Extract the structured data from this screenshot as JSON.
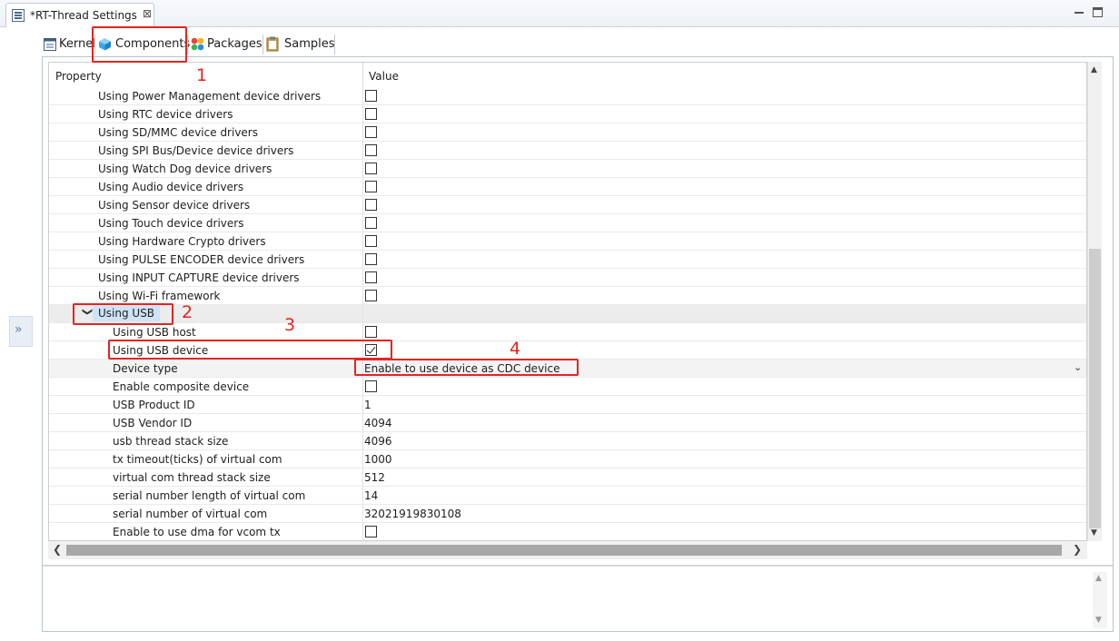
{
  "editor_tab": {
    "title": "*RT-Thread Settings",
    "close_glyph": "⊠"
  },
  "left_gutter": {
    "glyph": "»"
  },
  "inner_tabs": [
    {
      "label": "Kernel",
      "icon": "kernel-icon"
    },
    {
      "label": "Components",
      "icon": "cube-icon"
    },
    {
      "label": "Packages",
      "icon": "packages-icon"
    },
    {
      "label": "Samples",
      "icon": "clipboard-icon"
    }
  ],
  "table": {
    "header_property": "Property",
    "header_value": "Value",
    "rows": [
      {
        "label": "Using Power Management device drivers",
        "type": "checkbox",
        "checked": false
      },
      {
        "label": "Using RTC device drivers",
        "type": "checkbox",
        "checked": false
      },
      {
        "label": "Using SD/MMC device drivers",
        "type": "checkbox",
        "checked": false
      },
      {
        "label": "Using SPI Bus/Device device drivers",
        "type": "checkbox",
        "checked": false
      },
      {
        "label": "Using Watch Dog device drivers",
        "type": "checkbox",
        "checked": false
      },
      {
        "label": "Using Audio device drivers",
        "type": "checkbox",
        "checked": false
      },
      {
        "label": "Using Sensor device drivers",
        "type": "checkbox",
        "checked": false
      },
      {
        "label": "Using Touch device drivers",
        "type": "checkbox",
        "checked": false
      },
      {
        "label": "Using Hardware Crypto drivers",
        "type": "checkbox",
        "checked": false
      },
      {
        "label": "Using PULSE ENCODER device drivers",
        "type": "checkbox",
        "checked": false
      },
      {
        "label": "Using INPUT CAPTURE device drivers",
        "type": "checkbox",
        "checked": false
      },
      {
        "label": "Using Wi-Fi framework",
        "type": "checkbox",
        "checked": false
      },
      {
        "label": "Using USB",
        "type": "group",
        "expanded_glyph": "❯"
      },
      {
        "label": "Using USB host",
        "type": "checkbox",
        "checked": false
      },
      {
        "label": "Using USB device",
        "type": "checkbox",
        "checked": true
      },
      {
        "label": "Device type",
        "type": "combo",
        "value": "Enable to use device as CDC device",
        "arrow": "⌄"
      },
      {
        "label": "Enable composite device",
        "type": "checkbox",
        "checked": false
      },
      {
        "label": "USB Product ID",
        "type": "text",
        "value": "1"
      },
      {
        "label": "USB Vendor ID",
        "type": "text",
        "value": "4094"
      },
      {
        "label": "usb thread stack size",
        "type": "text",
        "value": "4096"
      },
      {
        "label": "tx timeout(ticks) of virtual com",
        "type": "text",
        "value": "1000"
      },
      {
        "label": "virtual com thread stack size",
        "type": "text",
        "value": "512"
      },
      {
        "label": "serial number length of virtual com",
        "type": "text",
        "value": "14"
      },
      {
        "label": "serial number of virtual com",
        "type": "text",
        "value": "32021919830108"
      },
      {
        "label": "Enable to use dma for vcom tx",
        "type": "checkbox",
        "checked": false
      }
    ]
  },
  "scroll": {
    "up": "▲",
    "down": "▼",
    "left": "❮",
    "right": "❯"
  },
  "annotations": [
    "1",
    "2",
    "3",
    "4"
  ],
  "colors": {
    "annotation_red": "#e52421",
    "selection_blue": "#cfe3f7",
    "group_bg": "#ececec"
  }
}
